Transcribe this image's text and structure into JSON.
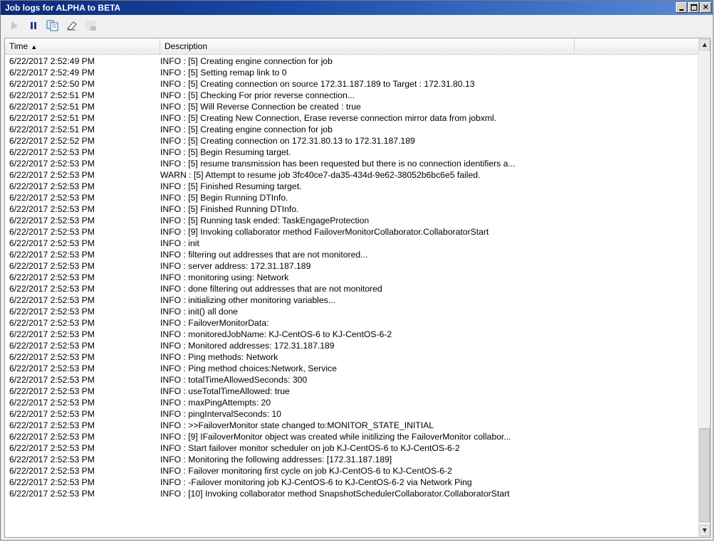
{
  "window": {
    "title": "Job logs for ALPHA to BETA",
    "close_glyph": "×"
  },
  "toolbar": {
    "icons": [
      "play-icon",
      "pause-icon",
      "copy-icon",
      "clear-icon",
      "filter-icon"
    ],
    "accent": "#1f7a2a"
  },
  "columns": {
    "time": "Time",
    "time_sort": "▲",
    "description": "Description",
    "extra": ""
  },
  "rows": [
    {
      "time": "6/22/2017 2:52:49 PM",
      "desc": "INFO : [5] Creating engine connection for job"
    },
    {
      "time": "6/22/2017 2:52:49 PM",
      "desc": "INFO : [5] Setting remap link to 0"
    },
    {
      "time": "6/22/2017 2:52:50 PM",
      "desc": "INFO : [5] Creating connection on source 172.31.187.189 to Target : 172.31.80.13"
    },
    {
      "time": "6/22/2017 2:52:51 PM",
      "desc": "INFO : [5] Checking For prior reverse connection..."
    },
    {
      "time": "6/22/2017 2:52:51 PM",
      "desc": "INFO : [5] Will Reverse Connection be created : true"
    },
    {
      "time": "6/22/2017 2:52:51 PM",
      "desc": "INFO : [5] Creating New Connection, Erase reverse connection mirror data from jobxml."
    },
    {
      "time": "6/22/2017 2:52:51 PM",
      "desc": "INFO : [5] Creating engine connection for job"
    },
    {
      "time": "6/22/2017 2:52:52 PM",
      "desc": "INFO : [5] Creating connection on 172.31.80.13 to 172.31.187.189"
    },
    {
      "time": "6/22/2017 2:52:53 PM",
      "desc": "INFO : [5] Begin Resuming target."
    },
    {
      "time": "6/22/2017 2:52:53 PM",
      "desc": "INFO : [5] resume transmission has been requested but there is no connection identifiers a..."
    },
    {
      "time": "6/22/2017 2:52:53 PM",
      "desc": "WARN : [5] Attempt to resume job 3fc40ce7-da35-434d-9e62-38052b6bc6e5 failed."
    },
    {
      "time": "6/22/2017 2:52:53 PM",
      "desc": "INFO : [5] Finished Resuming target."
    },
    {
      "time": "6/22/2017 2:52:53 PM",
      "desc": "INFO : [5] Begin Running DTInfo."
    },
    {
      "time": "6/22/2017 2:52:53 PM",
      "desc": "INFO : [5] Finished Running DTInfo."
    },
    {
      "time": "6/22/2017 2:52:53 PM",
      "desc": "INFO : [5] Running task ended: TaskEngageProtection"
    },
    {
      "time": "6/22/2017 2:52:53 PM",
      "desc": "INFO : [9] Invoking collaborator method FailoverMonitorCollaborator.CollaboratorStart"
    },
    {
      "time": "6/22/2017 2:52:53 PM",
      "desc": "INFO : init"
    },
    {
      "time": "6/22/2017 2:52:53 PM",
      "desc": "INFO : filtering out addresses that are not monitored..."
    },
    {
      "time": "6/22/2017 2:52:53 PM",
      "desc": "INFO : server address: 172.31.187.189"
    },
    {
      "time": "6/22/2017 2:52:53 PM",
      "desc": "INFO :    monitoring using: Network"
    },
    {
      "time": "6/22/2017 2:52:53 PM",
      "desc": "INFO : done filtering out addresses that are not monitored"
    },
    {
      "time": "6/22/2017 2:52:53 PM",
      "desc": "INFO : initializing other monitoring variables..."
    },
    {
      "time": "6/22/2017 2:52:53 PM",
      "desc": "INFO : init() all done"
    },
    {
      "time": "6/22/2017 2:52:53 PM",
      "desc": "INFO : FailoverMonitorData:"
    },
    {
      "time": "6/22/2017 2:52:53 PM",
      "desc": "INFO : monitoredJobName: KJ-CentOS-6 to KJ-CentOS-6-2"
    },
    {
      "time": "6/22/2017 2:52:53 PM",
      "desc": "INFO : Monitored addresses: 172.31.187.189"
    },
    {
      "time": "6/22/2017 2:52:53 PM",
      "desc": "INFO : Ping methods: Network"
    },
    {
      "time": "6/22/2017 2:52:53 PM",
      "desc": "INFO : Ping method choices:Network, Service"
    },
    {
      "time": "6/22/2017 2:52:53 PM",
      "desc": "INFO : totalTimeAllowedSeconds: 300"
    },
    {
      "time": "6/22/2017 2:52:53 PM",
      "desc": "INFO : useTotalTimeAllowed: true"
    },
    {
      "time": "6/22/2017 2:52:53 PM",
      "desc": "INFO : maxPingAttempts: 20"
    },
    {
      "time": "6/22/2017 2:52:53 PM",
      "desc": "INFO : pingIntervalSeconds: 10"
    },
    {
      "time": "6/22/2017 2:52:53 PM",
      "desc": "INFO : >>FailoverMonitor state changed to:MONITOR_STATE_INITIAL"
    },
    {
      "time": "6/22/2017 2:52:53 PM",
      "desc": "INFO : [9] IFailoverMonitor object was created while initilizing the FailoverMonitor collabor..."
    },
    {
      "time": "6/22/2017 2:52:53 PM",
      "desc": "INFO : Start failover monitor scheduler on job KJ-CentOS-6 to KJ-CentOS-6-2"
    },
    {
      "time": "6/22/2017 2:52:53 PM",
      "desc": "INFO : Monitoring the following addresses: [172.31.187.189]"
    },
    {
      "time": "6/22/2017 2:52:53 PM",
      "desc": "INFO : Failover monitoring first cycle on job KJ-CentOS-6 to KJ-CentOS-6-2"
    },
    {
      "time": "6/22/2017 2:52:53 PM",
      "desc": "INFO : -Failover monitoring job KJ-CentOS-6 to KJ-CentOS-6-2 via Network Ping"
    },
    {
      "time": "6/22/2017 2:52:53 PM",
      "desc": "INFO : [10] Invoking collaborator method SnapshotSchedulerCollaborator.CollaboratorStart"
    }
  ],
  "scrollbar": {
    "up_glyph": "▲",
    "down_glyph": "▼",
    "position": 0.96
  }
}
